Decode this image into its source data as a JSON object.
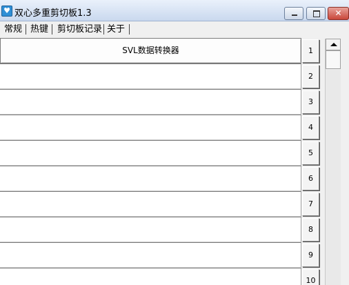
{
  "window": {
    "title": "双心多重剪切板1.3",
    "icon": "app-icon",
    "close_glyph": "✕"
  },
  "menu": {
    "items": [
      "常规",
      "热键",
      "剪切板记录",
      "关于"
    ]
  },
  "clipboard": {
    "entries": [
      {
        "text": "SVL数据转换器",
        "index": "1"
      },
      {
        "text": "",
        "index": "2"
      },
      {
        "text": "",
        "index": "3"
      },
      {
        "text": "",
        "index": "4"
      },
      {
        "text": "",
        "index": "5"
      },
      {
        "text": "",
        "index": "6"
      },
      {
        "text": "",
        "index": "7"
      },
      {
        "text": "",
        "index": "8"
      },
      {
        "text": "",
        "index": "9"
      },
      {
        "text": "",
        "index": "10"
      }
    ]
  }
}
